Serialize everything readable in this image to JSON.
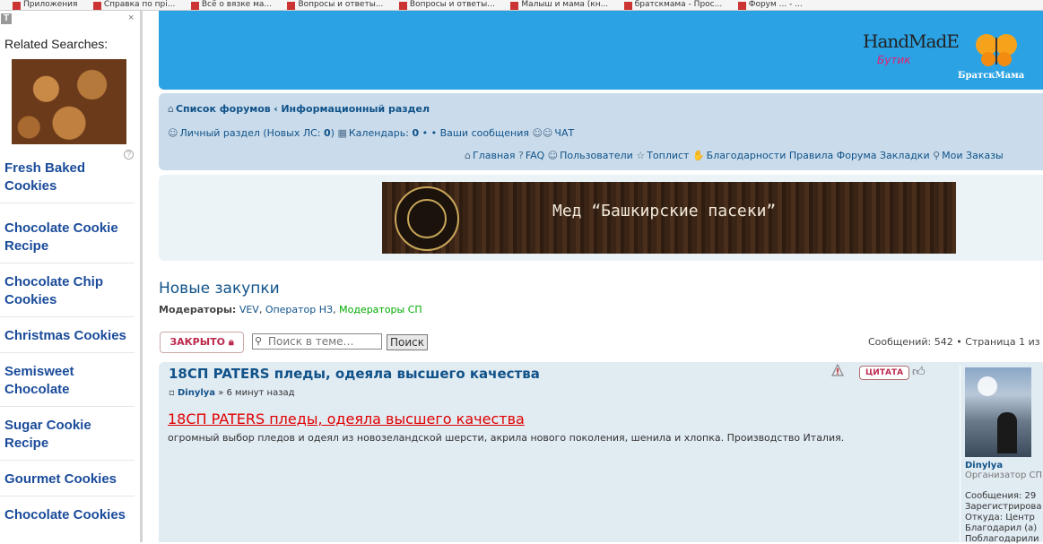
{
  "bookmarks": [
    "Приложения",
    "Справка по прі...",
    "Всё о вязке ма...",
    "Вопросы и ответы...",
    "Вопросы и ответы...",
    "Малыш и мама (кн...",
    "братскмама - Прос...",
    "Форум ... - ..."
  ],
  "sidebar": {
    "title": "Related Searches:",
    "close": "×",
    "logo": "T",
    "links": [
      "Fresh Baked Cookies",
      "Chocolate Cookie Recipe",
      "Chocolate Chip Cookies",
      "Christmas Cookies",
      "Semisweet Chocolate",
      "Sugar Cookie Recipe",
      "Gourmet Cookies",
      "Chocolate Cookies"
    ]
  },
  "header": {
    "logo_text": "HandMadE",
    "logo_sub": "Бутик",
    "brand": "БратскМама"
  },
  "nav": {
    "breadcrumb_home": "Список форумов",
    "breadcrumb_sep": "‹",
    "breadcrumb_current": "Информационный раздел",
    "personal": "Личный раздел (Новых ЛС: ",
    "personal_count": "0",
    "personal_end": ")",
    "calendar": "Календарь: ",
    "calendar_count": "0",
    "calendar_sep": "• •",
    "your_posts": "Ваши сообщения",
    "chat": "ЧАТ",
    "links": [
      "Главная",
      "FAQ",
      "Пользователи",
      "Топлист",
      "Благодарности",
      "Правила Форума",
      "Закладки",
      "Мои Заказы"
    ]
  },
  "banner": {
    "text": "Мед “Башкирские пасеки”"
  },
  "forum": {
    "title": "Новые закупки",
    "mods_label": "Модераторы:",
    "mod1": "VEV",
    "mod2": "Оператор НЗ",
    "mod3": "Модераторы СП"
  },
  "toolbar": {
    "closed_label": "ЗАКРЫТО",
    "search_placeholder": "Поиск в теме…",
    "search_button": "Поиск",
    "pagination": "Сообщений: 542 • Страница 1 из"
  },
  "post": {
    "title": "18СП PATERS пледы, одеяла высшего качества",
    "author": "Dinylya",
    "time": "» 6 минут назад",
    "link_text": "18СП PATERS пледы, одеяла высшего качества",
    "body": "огромный выбор пледов и одеял из новозеландской шерсти, акрила нового поколения, шенила и хлопка. Производство Италия.",
    "quote_label": "ЦИТАТА"
  },
  "profile": {
    "name": "Dinylya",
    "role": "Организатор СП",
    "posts": "Сообщения: 29",
    "registered": "Зарегистрирова",
    "from": "Откуда: Центр",
    "thanked": "Благодарил (а)",
    "thanked2": "Поблагодарили"
  },
  "colors": {
    "header_blue": "#2ba2e3",
    "nav_bg": "#cadceb",
    "link_blue": "#105289",
    "post_bg": "#e1ebf2",
    "red": "#e00000"
  }
}
